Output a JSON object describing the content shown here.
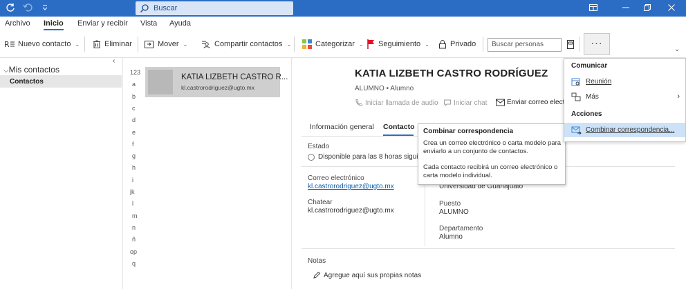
{
  "titlebar": {
    "search_placeholder": "Buscar"
  },
  "menu": [
    "Archivo",
    "Inicio",
    "Enviar y recibir",
    "Vista",
    "Ayuda"
  ],
  "ribbon": {
    "nuevo_contacto": "Nuevo contacto",
    "eliminar": "Eliminar",
    "mover": "Mover",
    "compartir": "Compartir contactos",
    "categorizar": "Categorizar",
    "seguimiento": "Seguimiento",
    "privado": "Privado",
    "buscar_personas": "Buscar personas",
    "more": "···"
  },
  "nav": {
    "section": "Mis contactos",
    "item": "Contactos"
  },
  "letters": [
    "123",
    "a",
    "b",
    "c",
    "d",
    "e",
    "f",
    "g",
    "h",
    "i",
    "jk",
    "l",
    "m",
    "n",
    "ñ",
    "op",
    "q"
  ],
  "contact": {
    "card_name": "KATIA LIZBETH CASTRO R...",
    "card_email": "kl.castrorodriguez@ugto.mx",
    "full_name": "KATIA LIZBETH CASTRO RODRÍGUEZ",
    "subtitle": "ALUMNO • Alumno",
    "actions": {
      "call": "Iniciar llamada de audio",
      "chat": "Iniciar chat",
      "email": "Enviar correo electró"
    },
    "tabs": [
      "Información general",
      "Contacto"
    ],
    "estado_label": "Estado",
    "estado_value": "Disponible para las 8 horas siguie",
    "correo_label": "Correo electrónico",
    "correo_value": "kl.castrorodriguez@ugto.mx",
    "chatear_label": "Chatear",
    "chatear_value": "kl.castrorodriguez@ugto.mx",
    "organizacion": "Universidad de Guanajuato",
    "puesto_label": "Puesto",
    "puesto_value": "ALUMNO",
    "depto_label": "Departamento",
    "depto_value": "Alumno",
    "notas_label": "Notas",
    "notas_placeholder": "Agregue aquí sus propias notas"
  },
  "tooltip": {
    "title": "Combinar correspondencia",
    "text1": "Crea un correo electrónico o carta modelo para enviarlo a un conjunto de contactos.",
    "text2": "Cada contacto recibirá un correo electrónico o carta modelo individual."
  },
  "dropdown": {
    "section1": "Comunicar",
    "reunion": "Reunión",
    "mas": "Más",
    "section2": "Acciones",
    "combinar": "Combinar correspondencia..."
  }
}
